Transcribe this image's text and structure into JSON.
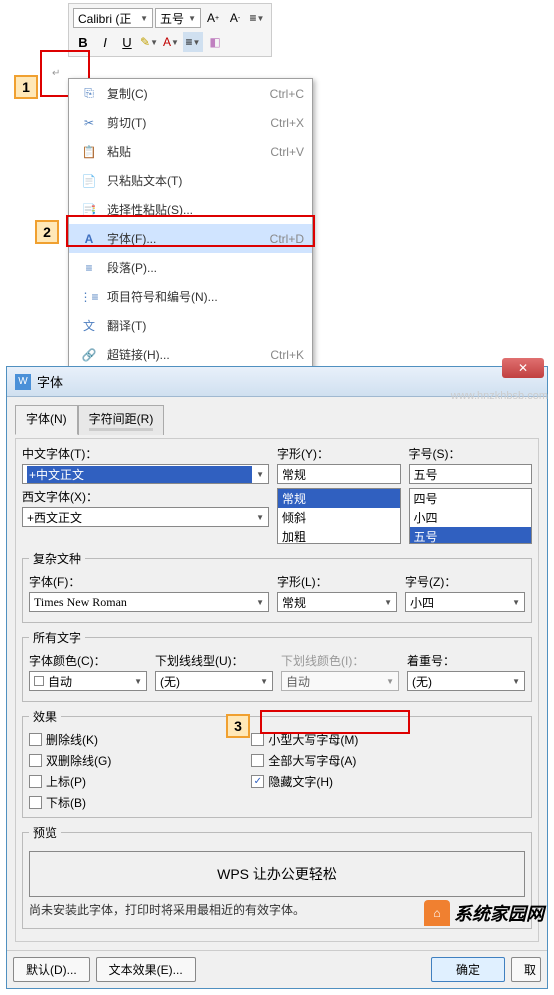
{
  "toolbar": {
    "font": "Calibri (正",
    "size": "五号",
    "buttons": {
      "bold": "B",
      "italic": "I",
      "underline": "U"
    }
  },
  "contextMenu": [
    {
      "icon": "📋",
      "label": "复制(C)",
      "shortcut": "Ctrl+C"
    },
    {
      "icon": "✂",
      "label": "剪切(T)",
      "shortcut": "Ctrl+X"
    },
    {
      "icon": "📄",
      "label": "粘贴",
      "shortcut": "Ctrl+V"
    },
    {
      "icon": "📝",
      "label": "只粘贴文本(T)",
      "shortcut": ""
    },
    {
      "icon": "📑",
      "label": "选择性粘贴(S)...",
      "shortcut": ""
    },
    {
      "icon": "A",
      "label": "字体(F)...",
      "shortcut": "Ctrl+D",
      "hl": true
    },
    {
      "icon": "≡",
      "label": "段落(P)...",
      "shortcut": ""
    },
    {
      "icon": "⋮≡",
      "label": "项目符号和编号(N)...",
      "shortcut": ""
    },
    {
      "icon": "🔤",
      "label": "翻译(T)",
      "shortcut": ""
    },
    {
      "icon": "🔗",
      "label": "超链接(H)...",
      "shortcut": "Ctrl+K"
    }
  ],
  "dialog": {
    "title": "字体",
    "tabs": [
      "字体(N)",
      "字符间距(R)"
    ],
    "cnFontLabel": "中文字体(T)：",
    "cnFont": "+中文正文",
    "styleLabel": "字形(Y)：",
    "style": "常规",
    "styleOptions": [
      "常规",
      "倾斜",
      "加粗"
    ],
    "sizeLabel": "字号(S)：",
    "size": "五号",
    "sizeOptions": [
      "四号",
      "小四",
      "五号"
    ],
    "enFontLabel": "西文字体(X)：",
    "enFont": "+西文正文",
    "complex": {
      "legend": "复杂文种",
      "fontLabel": "字体(F)：",
      "font": "Times New Roman",
      "styleLabel": "字形(L)：",
      "style": "常规",
      "sizeLabel": "字号(Z)：",
      "size": "小四"
    },
    "allText": {
      "legend": "所有文字",
      "colorLabel": "字体颜色(C)：",
      "color": "自动",
      "underlineLabel": "下划线线型(U)：",
      "underline": "(无)",
      "ulColorLabel": "下划线颜色(I)：",
      "ulColor": "自动",
      "emphasisLabel": "着重号：",
      "emphasis": "(无)"
    },
    "effects": {
      "legend": "效果",
      "left": [
        "删除线(K)",
        "双删除线(G)",
        "上标(P)",
        "下标(B)"
      ],
      "right": [
        "小型大写字母(M)",
        "全部大写字母(A)",
        "隐藏文字(H)"
      ]
    },
    "preview": {
      "legend": "预览",
      "text": "WPS 让办公更轻松"
    },
    "note": "尚未安装此字体，打印时将采用最相近的有效字体。",
    "buttons": {
      "default": "默认(D)...",
      "textEffect": "文本效果(E)...",
      "ok": "确定",
      "cancel": "取"
    }
  },
  "watermark": "www.hnzkhbsb.com",
  "brand": "系统家园网"
}
